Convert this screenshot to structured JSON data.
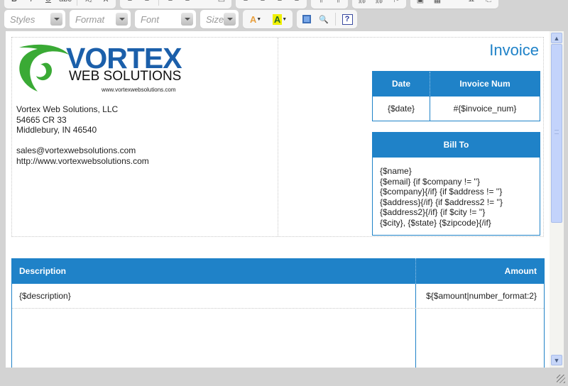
{
  "toolbar": {
    "row1_icons": [
      "bold-icon",
      "italic-icon",
      "underline-icon",
      "strikethrough-icon",
      "subscript-icon",
      "remove-format-icon",
      "numbered-list-icon",
      "bulleted-list-icon",
      "outdent-icon",
      "indent-icon",
      "blockquote-icon",
      "div-icon",
      "align-left-icon",
      "align-center-icon",
      "align-right-icon",
      "justify-icon",
      "link-icon",
      "unlink-icon",
      "anchor-icon",
      "image-icon",
      "table-icon",
      "horizontal-rule-icon",
      "special-char-icon",
      "page-break-icon"
    ],
    "combos": {
      "styles": "Styles",
      "format": "Format",
      "font": "Font",
      "size": "Size"
    },
    "text_color_glyph": "A",
    "bg_color_glyph": "A",
    "help_glyph": "?"
  },
  "document": {
    "logo": {
      "name": "VORTEX",
      "tagline": "WEB SOLUTIONS",
      "url": "www.vortexwebsolutions.com"
    },
    "company": {
      "lines": [
        "Vortex Web Solutions, LLC",
        "54665 CR 33",
        "Middlebury, IN 46540",
        "",
        "sales@vortexwebsolutions.com",
        "http://www.vortexwebsolutions.com"
      ]
    },
    "invoice_title": "Invoice",
    "meta_table": {
      "headers": [
        "Date",
        "Invoice Num"
      ],
      "values": [
        "{$date}",
        "#{$invoice_num}"
      ]
    },
    "bill_to": {
      "header": "Bill To",
      "lines": [
        "{$name}",
        "{$email} {if $company != ''}",
        "{$company}{/if} {if $address != ''}",
        "{$address}{/if} {if $address2 != ''}",
        "{$address2}{/if} {if $city != ''}",
        "{$city}, {$state} {$zipcode}{/if}"
      ]
    },
    "items_table": {
      "headers": [
        "Description",
        "Amount"
      ],
      "rows": [
        [
          "{$description}",
          "${$amount|number_format:2}"
        ]
      ]
    }
  },
  "colors": {
    "accent": "#1f82c8",
    "logo_blue": "#1b5faa",
    "logo_green": "#3aaa35"
  }
}
